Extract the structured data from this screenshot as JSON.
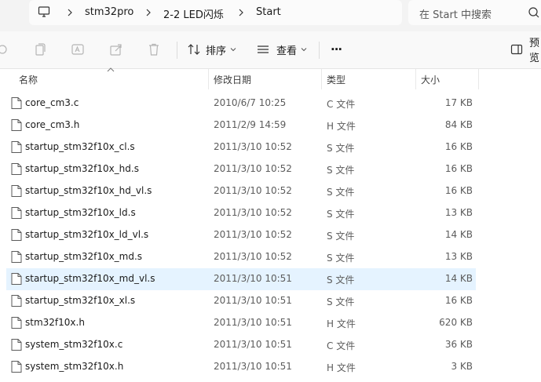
{
  "address": {
    "crumbs": [
      "stm32pro",
      "2-2 LED闪烁",
      "Start"
    ]
  },
  "search": {
    "placeholder": "在 Start 中搜索"
  },
  "toolbar": {
    "sort_label": "排序",
    "view_label": "查看",
    "more_label": "···",
    "preview_label": "预览"
  },
  "columns": {
    "name": "名称",
    "date": "修改日期",
    "type": "类型",
    "size": "大小"
  },
  "files": [
    {
      "name": "core_cm3.c",
      "date": "2010/6/7 10:25",
      "type": "C 文件",
      "size": "17 KB"
    },
    {
      "name": "core_cm3.h",
      "date": "2011/2/9 14:59",
      "type": "H 文件",
      "size": "84 KB"
    },
    {
      "name": "startup_stm32f10x_cl.s",
      "date": "2011/3/10 10:52",
      "type": "S 文件",
      "size": "16 KB"
    },
    {
      "name": "startup_stm32f10x_hd.s",
      "date": "2011/3/10 10:52",
      "type": "S 文件",
      "size": "16 KB"
    },
    {
      "name": "startup_stm32f10x_hd_vl.s",
      "date": "2011/3/10 10:52",
      "type": "S 文件",
      "size": "16 KB"
    },
    {
      "name": "startup_stm32f10x_ld.s",
      "date": "2011/3/10 10:52",
      "type": "S 文件",
      "size": "13 KB"
    },
    {
      "name": "startup_stm32f10x_ld_vl.s",
      "date": "2011/3/10 10:52",
      "type": "S 文件",
      "size": "14 KB"
    },
    {
      "name": "startup_stm32f10x_md.s",
      "date": "2011/3/10 10:52",
      "type": "S 文件",
      "size": "13 KB"
    },
    {
      "name": "startup_stm32f10x_md_vl.s",
      "date": "2011/3/10 10:51",
      "type": "S 文件",
      "size": "14 KB"
    },
    {
      "name": "startup_stm32f10x_xl.s",
      "date": "2011/3/10 10:51",
      "type": "S 文件",
      "size": "16 KB"
    },
    {
      "name": "stm32f10x.h",
      "date": "2011/3/10 10:51",
      "type": "H 文件",
      "size": "620 KB"
    },
    {
      "name": "system_stm32f10x.c",
      "date": "2011/3/10 10:51",
      "type": "C 文件",
      "size": "36 KB"
    },
    {
      "name": "system_stm32f10x.h",
      "date": "2011/3/10 10:51",
      "type": "H 文件",
      "size": "3 KB"
    }
  ],
  "selected_row": 8,
  "colors": {
    "selection": "#e5f3ff",
    "toolbar_bg": "#f9f9f9",
    "address_bg": "#f3f3f3"
  },
  "icons": [
    "computer-icon",
    "chevron-right-icon",
    "search-icon",
    "cut-icon",
    "copy-icon",
    "rename-icon",
    "share-icon",
    "delete-icon",
    "sort-icon",
    "view-icon",
    "chevron-down-icon",
    "more-icon",
    "preview-pane-icon",
    "file-icon"
  ]
}
